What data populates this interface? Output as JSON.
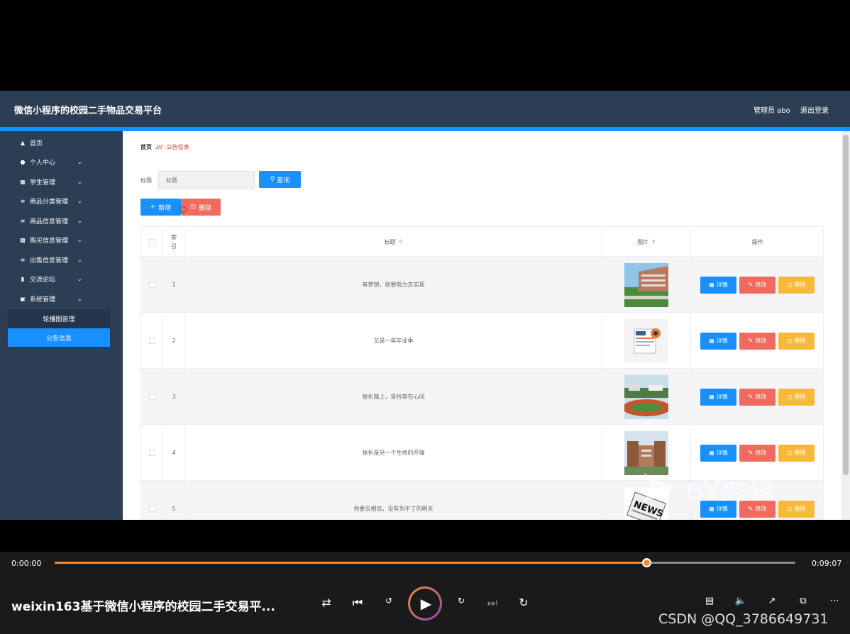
{
  "app": {
    "title": "微信小程序的校园二手物品交易平台",
    "user": "管理员 abo",
    "logout": "退出登录"
  },
  "sidebar": {
    "items": [
      {
        "label": "首页",
        "icon": "home-icon"
      },
      {
        "label": "个人中心",
        "icon": "user-icon"
      },
      {
        "label": "学生管理",
        "icon": "grid-icon"
      },
      {
        "label": "商品分类管理",
        "icon": "list-icon"
      },
      {
        "label": "商品信息管理",
        "icon": "list-icon"
      },
      {
        "label": "购买信息管理",
        "icon": "ticket-icon"
      },
      {
        "label": "出售信息管理",
        "icon": "list-icon"
      },
      {
        "label": "交流论坛",
        "icon": "bar-chart-icon"
      },
      {
        "label": "系统管理",
        "icon": "clipboard-icon"
      }
    ],
    "sub_items": [
      {
        "label": "轮播图管理"
      },
      {
        "label": "公告信息"
      }
    ]
  },
  "breadcrumb": {
    "home": "首页",
    "current": "公告信息"
  },
  "search": {
    "label": "标题",
    "placeholder": "标题",
    "button": "查询"
  },
  "toolbar": {
    "add": "新增",
    "delete": "删除"
  },
  "table": {
    "headers": {
      "index": "索引",
      "title": "标题",
      "image": "图片",
      "actions": "操作"
    },
    "rows": [
      {
        "index": "1",
        "title": "有梦想，就要努力去实现"
      },
      {
        "index": "2",
        "title": "又是一年毕业季"
      },
      {
        "index": "3",
        "title": "挫折路上，坚持常在心间"
      },
      {
        "index": "4",
        "title": "挫折是另一个生命的开端"
      },
      {
        "index": "5",
        "title": "你要去相信，没有到不了的明天"
      }
    ],
    "action_labels": {
      "detail": "详情",
      "edit": "修改",
      "remove": "删除"
    }
  },
  "watermark": {
    "text": "eV剪辑"
  },
  "player": {
    "current_time": "0:00:00",
    "total_time": "0:09:07",
    "progress": 0.8,
    "video_title": "weixin163基于微信小程序的校园二手交易平...",
    "credit": "CSDN @QQ_3786649731"
  },
  "colors": {
    "header_bg": "#2c3e54",
    "accent": "#1890ff",
    "danger": "#f06b5d",
    "warning": "#f7b93a",
    "progress": "#f08c3a"
  }
}
